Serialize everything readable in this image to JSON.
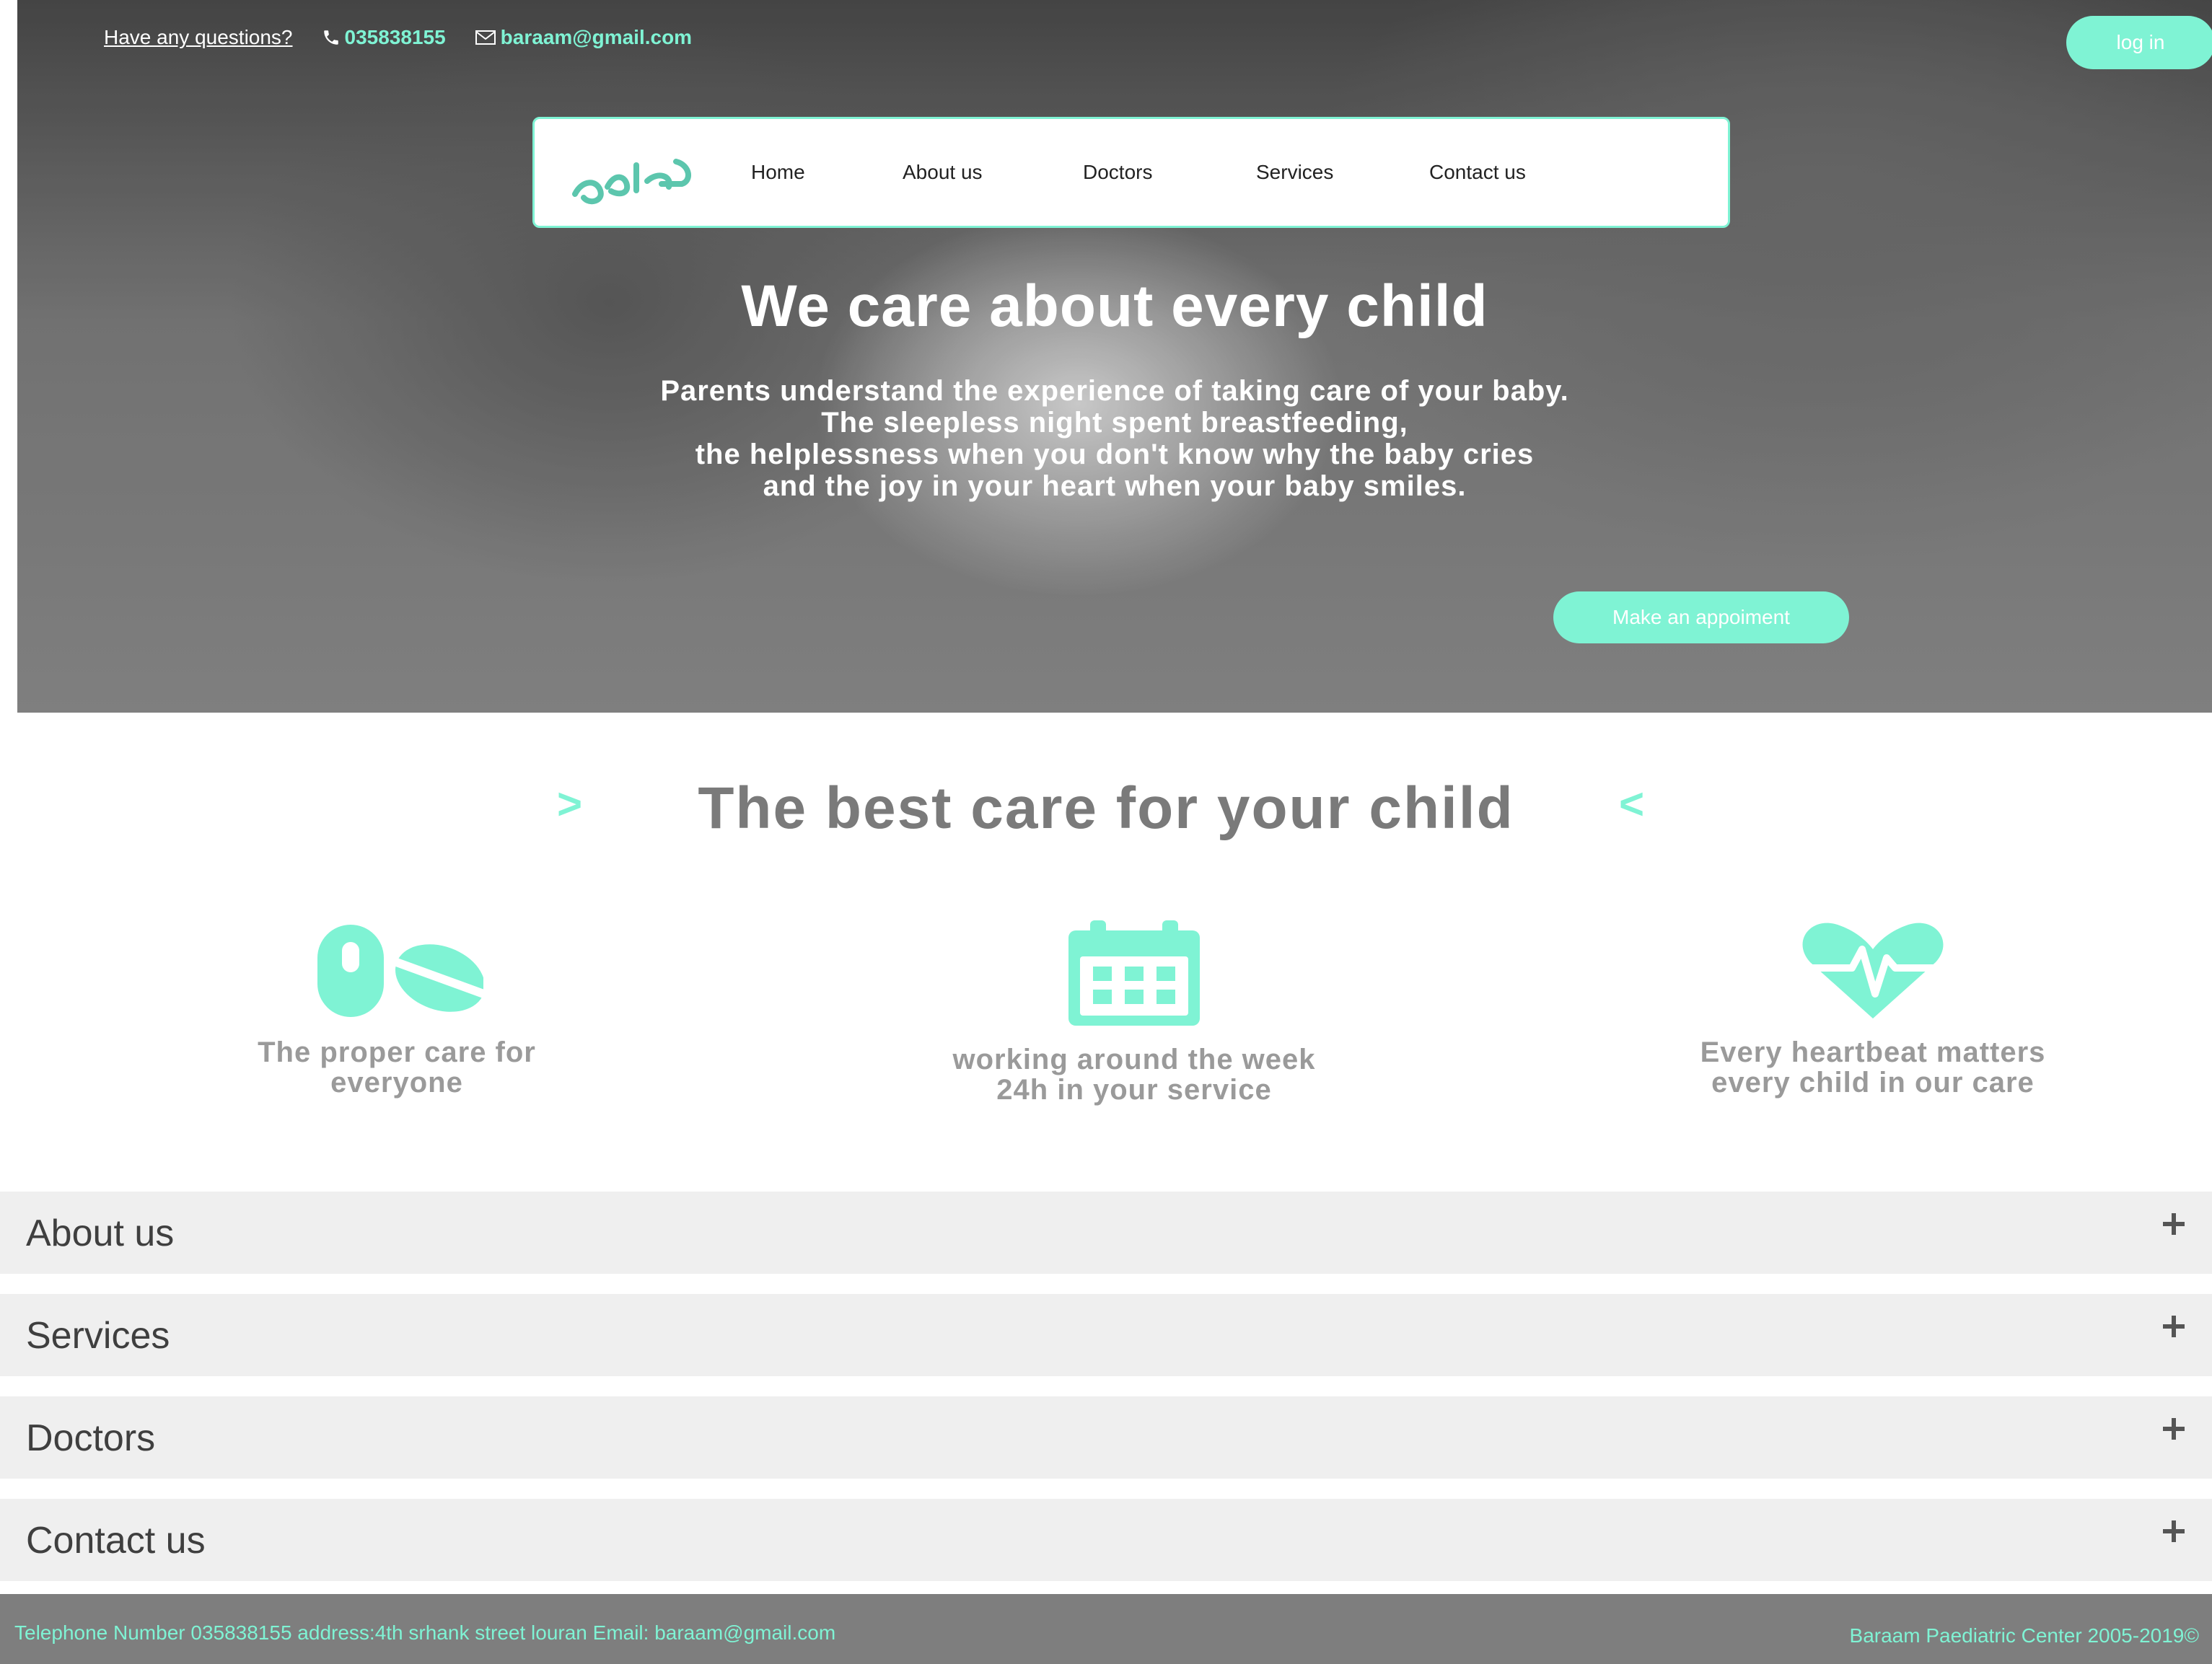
{
  "topbar": {
    "question": "Have any questions?",
    "phone": "035838155",
    "email": "baraam@gmail.com",
    "login_label": "log in"
  },
  "nav": {
    "logo_text": "براعم",
    "items": [
      "Home",
      "About us",
      "Doctors",
      "Services",
      "Contact us"
    ]
  },
  "hero": {
    "title": "We care about every child",
    "lines": [
      "Parents understand the experience of taking care of your baby.",
      "The sleepless night spent breastfeeding,",
      "the helplessness when you don't know why the baby cries",
      "and the joy in your heart when your baby smiles."
    ],
    "cta_label": "Make an appoiment"
  },
  "care": {
    "title": "The best care for your child",
    "left_chevron": ">",
    "right_chevron": "<",
    "features": [
      {
        "icon": "pills-icon",
        "line1": "The proper care for",
        "line2": "everyone"
      },
      {
        "icon": "calendar-icon",
        "line1": "working around the week",
        "line2": "24h in your service"
      },
      {
        "icon": "heartbeat-icon",
        "line1": "Every heartbeat matters",
        "line2": "every child in our care"
      }
    ]
  },
  "accordion": [
    "About us",
    "Services",
    "Doctors",
    "Contact us"
  ],
  "footer": {
    "contact": "Telephone Number 035838155 address:4th srhank street louran Email: baraam@gmail.com",
    "copyright": "Baraam Paediatric Center 2005-2019©"
  },
  "colors": {
    "accent": "#7ff3d4",
    "heading_gray": "#7a7a7a",
    "accordion_bg": "#efefef",
    "footer_bg": "#7e7e7e"
  }
}
